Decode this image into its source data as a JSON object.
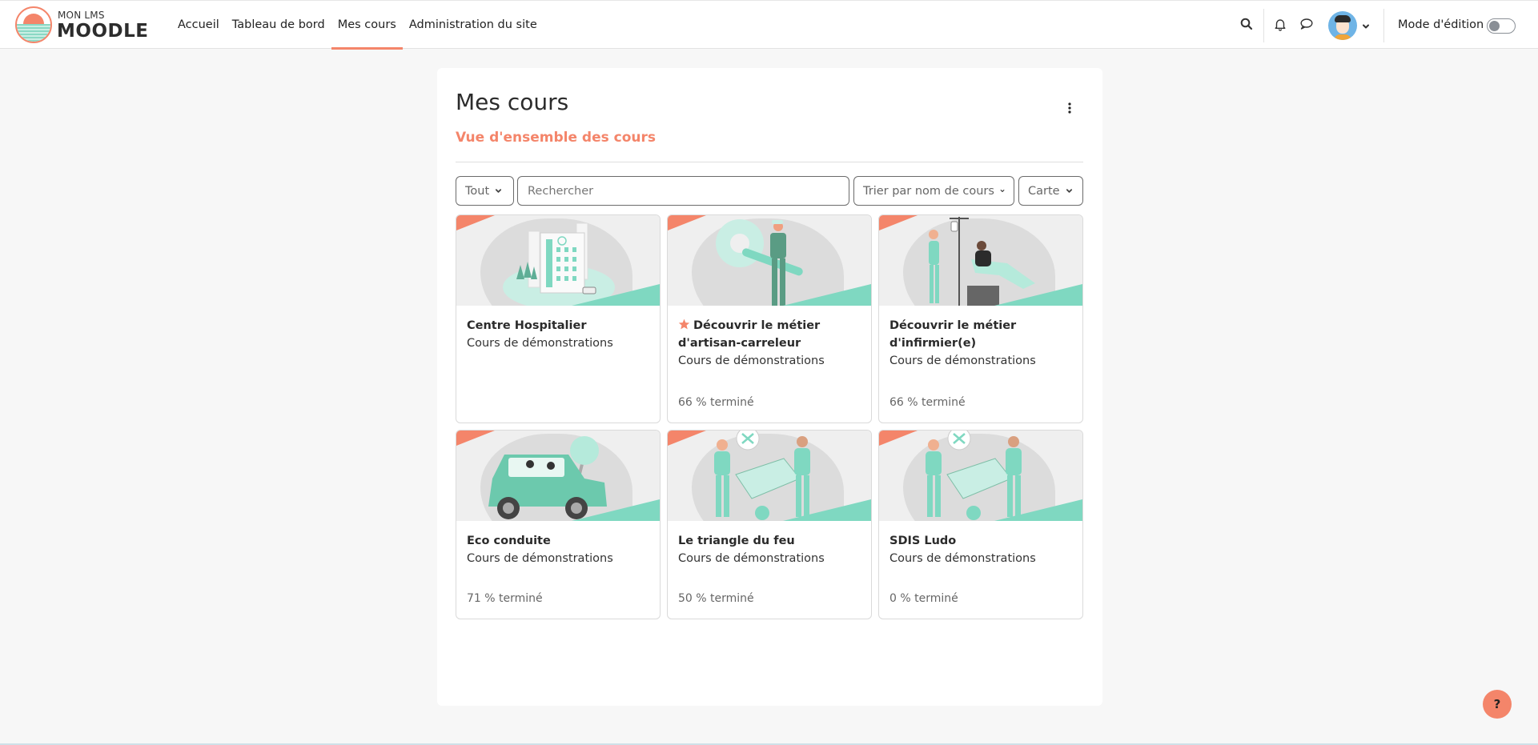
{
  "brand": {
    "top": "MON LMS",
    "main": "MOODLE"
  },
  "nav": {
    "items": [
      {
        "label": "Accueil",
        "active": false
      },
      {
        "label": "Tableau de bord",
        "active": false
      },
      {
        "label": "Mes cours",
        "active": true
      },
      {
        "label": "Administration du site",
        "active": false
      }
    ],
    "edit_mode_label": "Mode d'édition",
    "edit_mode_on": false,
    "icons": [
      "search-icon",
      "bell-icon",
      "chat-icon",
      "avatar",
      "chevron-down-icon"
    ]
  },
  "page": {
    "title": "Mes cours",
    "section_title": "Vue d'ensemble des cours"
  },
  "filters": {
    "grouping": "Tout",
    "search_placeholder": "Rechercher",
    "search_value": "",
    "sort": "Trier par nom de cours",
    "view": "Carte"
  },
  "courses": [
    {
      "name": "Centre Hospitalier",
      "category": "Cours de démonstrations",
      "progress": "",
      "starred": false,
      "illustration": "hospital"
    },
    {
      "name": "Découvrir le métier d'artisan-carreleur",
      "category": "Cours de démonstrations",
      "progress": "66 % terminé",
      "starred": true,
      "illustration": "worker-wrench"
    },
    {
      "name": "Découvrir le métier d'infirmier(e)",
      "category": "Cours de démonstrations",
      "progress": "66 % terminé",
      "starred": false,
      "illustration": "nurse-patient"
    },
    {
      "name": "Eco conduite",
      "category": "Cours de démonstrations",
      "progress": "71 % terminé",
      "starred": false,
      "illustration": "car"
    },
    {
      "name": "Le triangle du feu",
      "category": "Cours de démonstrations",
      "progress": "50 % terminé",
      "starred": false,
      "illustration": "firefighters"
    },
    {
      "name": "SDIS Ludo",
      "category": "Cours de démonstrations",
      "progress": "0 % terminé",
      "starred": false,
      "illustration": "firefighters"
    }
  ],
  "help_label": "?",
  "colors": {
    "accent": "#f4856a",
    "mint": "#7fd8c1",
    "background": "#f7f7f7"
  }
}
